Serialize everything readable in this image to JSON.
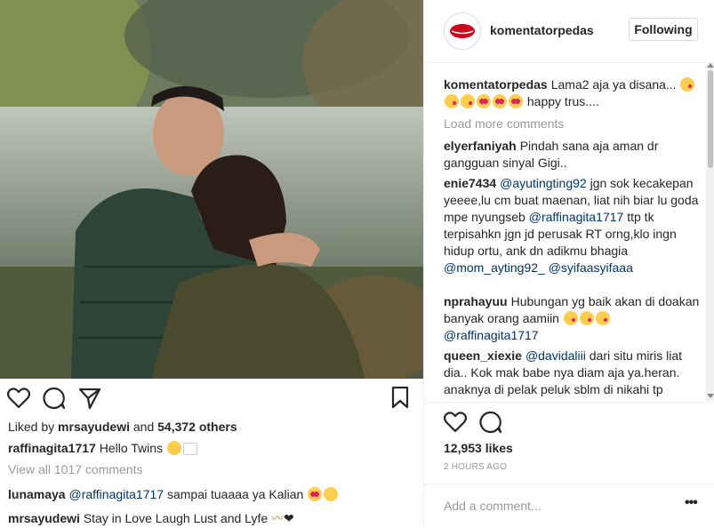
{
  "colors": {
    "link": "#003569",
    "muted": "#999999",
    "text": "#262626",
    "border": "#efefef"
  },
  "post": {
    "liked_by_prefix": "Liked by",
    "liked_by_user": "mrsayudewi",
    "liked_by_and": "and",
    "liked_by_others": "54,372 others",
    "caption_user": "raffinagita1717",
    "caption_text": "Hello Twins",
    "view_all": "View all 1017 comments",
    "caption_comments": [
      {
        "user": "lunamaya",
        "mention": "@raffinagita1717",
        "text": "sampai tuaaaa ya Kalian"
      },
      {
        "user": "mrsayudewi",
        "text": "Stay in Love Laugh Lust and Lyfe"
      }
    ]
  },
  "panel": {
    "header_user": "komentatorpedas",
    "follow_label": "Following",
    "first_comment": {
      "user": "komentatorpedas",
      "text": "Lama2 aja ya disana...",
      "text2": "happy trus...."
    },
    "load_more": "Load more comments",
    "comments": [
      {
        "user": "elyerfaniyah",
        "text": "Pindah sana aja aman dr gangguan sinyal Gigi.."
      },
      {
        "user": "enie7434",
        "mention1": "@ayutingting92",
        "text1": "jgn sok kecakepan yeeee,lu cm buat maenan, liat nih biar lu goda mpe nyungseb",
        "mention2": "@raffinagita1717",
        "text2": "ttp tk terpisahkn jgn jd perusak RT orng,klo ingn hidup ortu, ank dn adikmu bhagia",
        "mention3": "@mom_ayting92_",
        "mention4": "@syifaasyifaaa"
      },
      {
        "user": "nprahayuu",
        "text": "Hubungan yg baik akan di doakan banyak orang aamiin",
        "mention": "@raffinagita1717"
      },
      {
        "user": "queen_xiexie",
        "mention": "@davidaliii",
        "text": "dari situ miris liat dia.. Kok mak babe nya diam aja ya.heran. anaknya di pelak peluk sblm di nikahi tp ortunya malah biarin aja. Pun punya"
      }
    ],
    "likes": "12,953 likes",
    "time_ago": "2 HOURS AGO",
    "add_comment_placeholder": "Add a comment...",
    "more_label": "•••"
  }
}
